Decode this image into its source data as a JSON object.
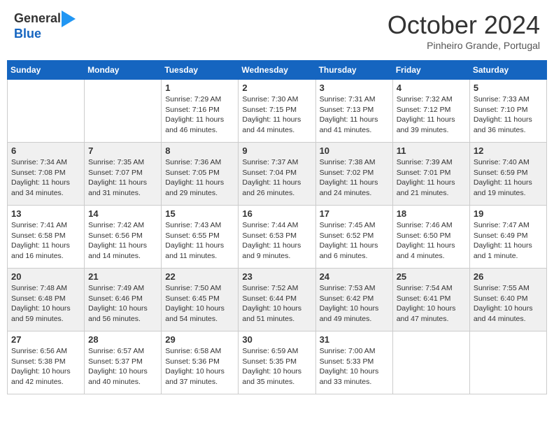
{
  "header": {
    "logo_line1": "General",
    "logo_line2": "Blue",
    "month": "October 2024",
    "location": "Pinheiro Grande, Portugal"
  },
  "weekdays": [
    "Sunday",
    "Monday",
    "Tuesday",
    "Wednesday",
    "Thursday",
    "Friday",
    "Saturday"
  ],
  "weeks": [
    [
      {
        "day": "",
        "info": ""
      },
      {
        "day": "",
        "info": ""
      },
      {
        "day": "1",
        "info": "Sunrise: 7:29 AM\nSunset: 7:16 PM\nDaylight: 11 hours and 46 minutes."
      },
      {
        "day": "2",
        "info": "Sunrise: 7:30 AM\nSunset: 7:15 PM\nDaylight: 11 hours and 44 minutes."
      },
      {
        "day": "3",
        "info": "Sunrise: 7:31 AM\nSunset: 7:13 PM\nDaylight: 11 hours and 41 minutes."
      },
      {
        "day": "4",
        "info": "Sunrise: 7:32 AM\nSunset: 7:12 PM\nDaylight: 11 hours and 39 minutes."
      },
      {
        "day": "5",
        "info": "Sunrise: 7:33 AM\nSunset: 7:10 PM\nDaylight: 11 hours and 36 minutes."
      }
    ],
    [
      {
        "day": "6",
        "info": "Sunrise: 7:34 AM\nSunset: 7:08 PM\nDaylight: 11 hours and 34 minutes."
      },
      {
        "day": "7",
        "info": "Sunrise: 7:35 AM\nSunset: 7:07 PM\nDaylight: 11 hours and 31 minutes."
      },
      {
        "day": "8",
        "info": "Sunrise: 7:36 AM\nSunset: 7:05 PM\nDaylight: 11 hours and 29 minutes."
      },
      {
        "day": "9",
        "info": "Sunrise: 7:37 AM\nSunset: 7:04 PM\nDaylight: 11 hours and 26 minutes."
      },
      {
        "day": "10",
        "info": "Sunrise: 7:38 AM\nSunset: 7:02 PM\nDaylight: 11 hours and 24 minutes."
      },
      {
        "day": "11",
        "info": "Sunrise: 7:39 AM\nSunset: 7:01 PM\nDaylight: 11 hours and 21 minutes."
      },
      {
        "day": "12",
        "info": "Sunrise: 7:40 AM\nSunset: 6:59 PM\nDaylight: 11 hours and 19 minutes."
      }
    ],
    [
      {
        "day": "13",
        "info": "Sunrise: 7:41 AM\nSunset: 6:58 PM\nDaylight: 11 hours and 16 minutes."
      },
      {
        "day": "14",
        "info": "Sunrise: 7:42 AM\nSunset: 6:56 PM\nDaylight: 11 hours and 14 minutes."
      },
      {
        "day": "15",
        "info": "Sunrise: 7:43 AM\nSunset: 6:55 PM\nDaylight: 11 hours and 11 minutes."
      },
      {
        "day": "16",
        "info": "Sunrise: 7:44 AM\nSunset: 6:53 PM\nDaylight: 11 hours and 9 minutes."
      },
      {
        "day": "17",
        "info": "Sunrise: 7:45 AM\nSunset: 6:52 PM\nDaylight: 11 hours and 6 minutes."
      },
      {
        "day": "18",
        "info": "Sunrise: 7:46 AM\nSunset: 6:50 PM\nDaylight: 11 hours and 4 minutes."
      },
      {
        "day": "19",
        "info": "Sunrise: 7:47 AM\nSunset: 6:49 PM\nDaylight: 11 hours and 1 minute."
      }
    ],
    [
      {
        "day": "20",
        "info": "Sunrise: 7:48 AM\nSunset: 6:48 PM\nDaylight: 10 hours and 59 minutes."
      },
      {
        "day": "21",
        "info": "Sunrise: 7:49 AM\nSunset: 6:46 PM\nDaylight: 10 hours and 56 minutes."
      },
      {
        "day": "22",
        "info": "Sunrise: 7:50 AM\nSunset: 6:45 PM\nDaylight: 10 hours and 54 minutes."
      },
      {
        "day": "23",
        "info": "Sunrise: 7:52 AM\nSunset: 6:44 PM\nDaylight: 10 hours and 51 minutes."
      },
      {
        "day": "24",
        "info": "Sunrise: 7:53 AM\nSunset: 6:42 PM\nDaylight: 10 hours and 49 minutes."
      },
      {
        "day": "25",
        "info": "Sunrise: 7:54 AM\nSunset: 6:41 PM\nDaylight: 10 hours and 47 minutes."
      },
      {
        "day": "26",
        "info": "Sunrise: 7:55 AM\nSunset: 6:40 PM\nDaylight: 10 hours and 44 minutes."
      }
    ],
    [
      {
        "day": "27",
        "info": "Sunrise: 6:56 AM\nSunset: 5:38 PM\nDaylight: 10 hours and 42 minutes."
      },
      {
        "day": "28",
        "info": "Sunrise: 6:57 AM\nSunset: 5:37 PM\nDaylight: 10 hours and 40 minutes."
      },
      {
        "day": "29",
        "info": "Sunrise: 6:58 AM\nSunset: 5:36 PM\nDaylight: 10 hours and 37 minutes."
      },
      {
        "day": "30",
        "info": "Sunrise: 6:59 AM\nSunset: 5:35 PM\nDaylight: 10 hours and 35 minutes."
      },
      {
        "day": "31",
        "info": "Sunrise: 7:00 AM\nSunset: 5:33 PM\nDaylight: 10 hours and 33 minutes."
      },
      {
        "day": "",
        "info": ""
      },
      {
        "day": "",
        "info": ""
      }
    ]
  ]
}
